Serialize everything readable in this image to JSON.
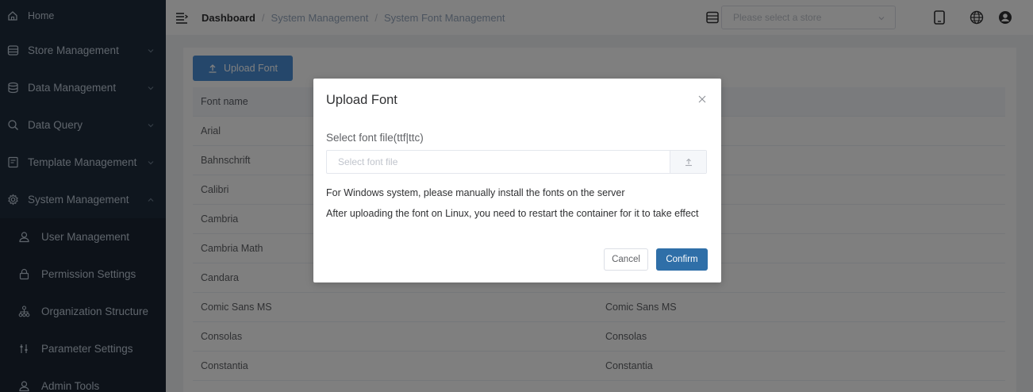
{
  "sidebar": {
    "home": {
      "label": "Home",
      "icon": "home-icon"
    },
    "items": [
      {
        "label": "Store Management",
        "icon": "store-icon"
      },
      {
        "label": "Data Management",
        "icon": "database-icon"
      },
      {
        "label": "Data Query",
        "icon": "search-icon"
      },
      {
        "label": "Template Management",
        "icon": "template-icon"
      },
      {
        "label": "System Management",
        "icon": "gear-icon"
      }
    ],
    "sub_items": [
      {
        "label": "User Management",
        "icon": "user-icon"
      },
      {
        "label": "Permission Settings",
        "icon": "lock-icon"
      },
      {
        "label": "Organization Structure",
        "icon": "org-icon"
      },
      {
        "label": "Parameter Settings",
        "icon": "sliders-icon"
      },
      {
        "label": "Admin Tools",
        "icon": "user-icon"
      }
    ]
  },
  "header": {
    "breadcrumb": [
      "Dashboard",
      "System Management",
      "System Font Management"
    ],
    "separator": "/",
    "store_placeholder": "Please select a store"
  },
  "main": {
    "upload_label": "Upload Font",
    "columns": [
      "Font name",
      ""
    ],
    "rows": [
      [
        "Arial",
        ""
      ],
      [
        "Bahnschrift",
        ""
      ],
      [
        "Calibri",
        ""
      ],
      [
        "Cambria",
        ""
      ],
      [
        "Cambria Math",
        ""
      ],
      [
        "Candara",
        ""
      ],
      [
        "Comic Sans MS",
        "Comic Sans MS"
      ],
      [
        "Consolas",
        "Consolas"
      ],
      [
        "Constantia",
        "Constantia"
      ]
    ]
  },
  "dialog": {
    "title": "Upload Font",
    "label": "Select font file(ttf|ttc)",
    "placeholder": "Select font file",
    "note_windows": "For Windows system, please manually install the fonts on the server",
    "note_linux": "After uploading the font on Linux, you need to restart the container for it to take effect",
    "cancel": "Cancel",
    "confirm": "Confirm"
  },
  "colors": {
    "sidebar_bg": "#1f2d3d",
    "primary": "#4a8fd6",
    "confirm": "#2f6fa8"
  }
}
